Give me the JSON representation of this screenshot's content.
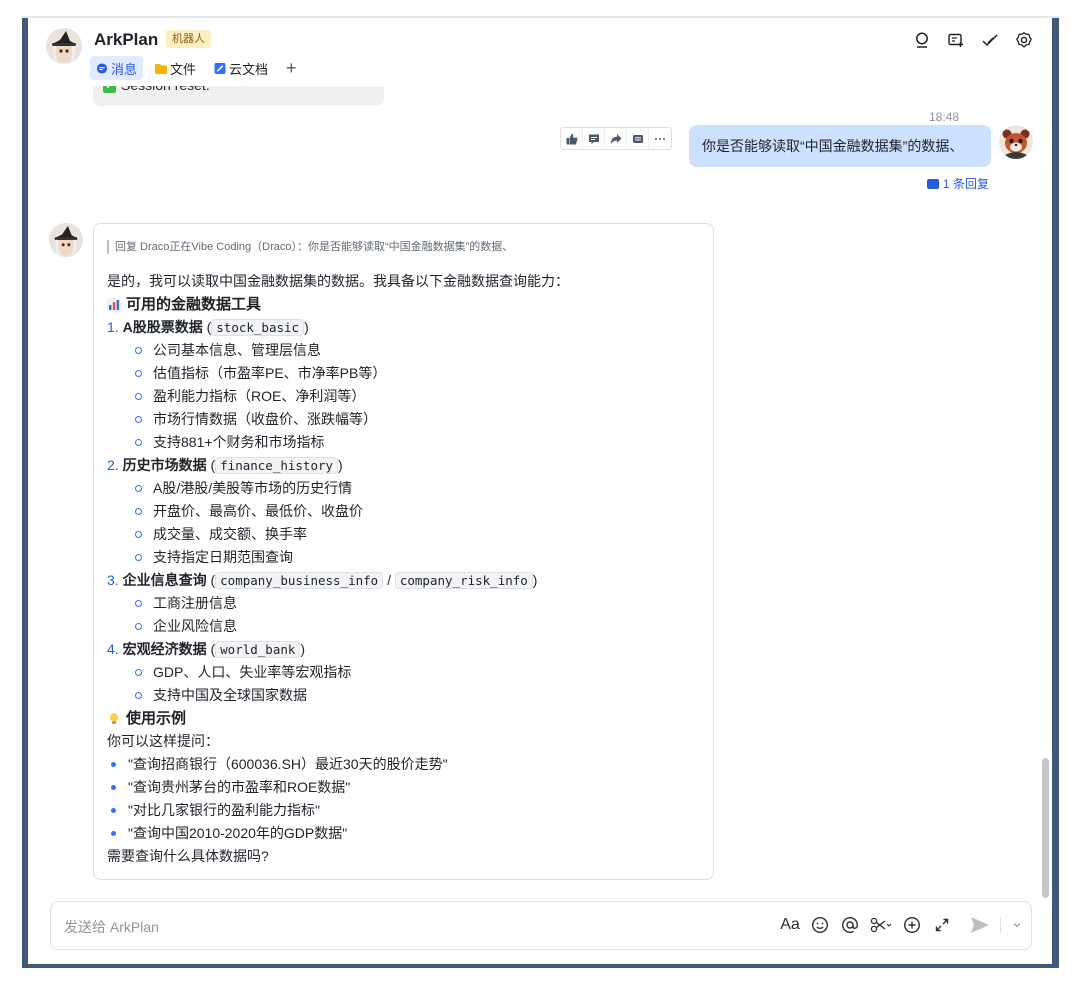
{
  "header": {
    "title": "ArkPlan",
    "badge": "机器人",
    "tabs": [
      {
        "label": "消息",
        "icon": "chat-bubble-icon",
        "active": true
      },
      {
        "label": "文件",
        "icon": "folder-icon",
        "active": false
      },
      {
        "label": "云文档",
        "icon": "doc-icon",
        "active": false
      }
    ],
    "add_tab": "+",
    "icons": [
      "search-icon",
      "new-chat-icon",
      "task-check-icon",
      "settings-icon"
    ]
  },
  "previous_message": {
    "text": "Session reset."
  },
  "user_message": {
    "time": "18:48",
    "text": "你是否能够读取“中国金融数据集”的数据、",
    "reply_count": "1 条回复",
    "tools": [
      "thumbs-up-icon",
      "comment-icon",
      "forward-icon",
      "more-action-icon",
      "ellipsis-icon"
    ]
  },
  "bot_message": {
    "quote": "回复 Draco正在Vibe Coding（Draco）：你是否能够读取“中国金融数据集”的数据、",
    "intro": "是的，我可以读取中国金融数据集的数据。我具备以下金融数据查询能力：",
    "tools_heading": "可用的金融数据工具",
    "tools": [
      {
        "num": "1.",
        "name": "A股股票数据",
        "codes": [
          "stock_basic"
        ],
        "items": [
          "公司基本信息、管理层信息",
          "估值指标（市盈率PE、市净率PB等）",
          "盈利能力指标（ROE、净利润等）",
          "市场行情数据（收盘价、涨跌幅等）",
          "支持881+个财务和市场指标"
        ]
      },
      {
        "num": "2.",
        "name": "历史市场数据",
        "codes": [
          "finance_history"
        ],
        "items": [
          "A股/港股/美股等市场的历史行情",
          "开盘价、最高价、最低价、收盘价",
          "成交量、成交额、换手率",
          "支持指定日期范围查询"
        ]
      },
      {
        "num": "3.",
        "name": "企业信息查询",
        "codes": [
          "company_business_info",
          "company_risk_info"
        ],
        "items": [
          "工商注册信息",
          "企业风险信息"
        ]
      },
      {
        "num": "4.",
        "name": "宏观经济数据",
        "codes": [
          "world_bank"
        ],
        "items": [
          "GDP、人口、失业率等宏观指标",
          "支持中国及全球国家数据"
        ]
      }
    ],
    "examples_heading": "使用示例",
    "examples_intro": "你可以这样提问：",
    "examples": [
      "\"查询招商银行（600036.SH）最近30天的股价走势\"",
      "\"查询贵州茅台的市盈率和ROE数据\"",
      "\"对比几家银行的盈利能力指标\"",
      "\"查询中国2010-2020年的GDP数据\""
    ],
    "closing": "需要查询什么具体数据吗?"
  },
  "composer": {
    "placeholder": "发送给 ArkPlan",
    "font_button": "Aa",
    "icons": [
      "text-format-icon",
      "emoji-icon",
      "mention-icon",
      "scissors-icon",
      "add-circle-icon",
      "expand-icon",
      "send-icon",
      "chevron-down-icon"
    ]
  },
  "colors": {
    "accent": "#245bdb",
    "user_bubble": "#cce0ff",
    "badge_bg": "#fcf0c2",
    "frame": "#41587a"
  }
}
